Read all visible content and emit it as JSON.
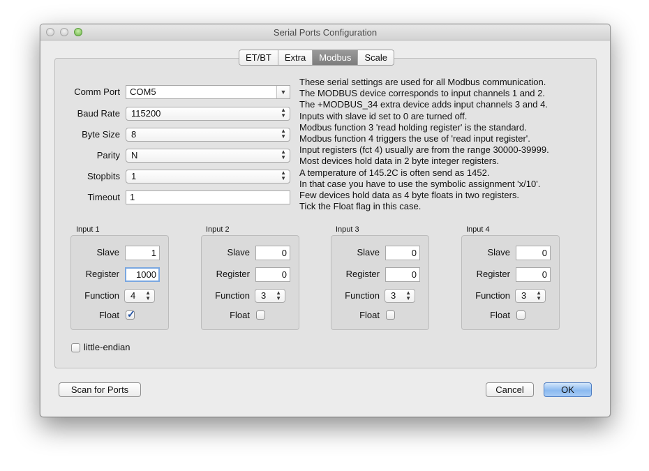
{
  "window": {
    "title": "Serial Ports Configuration"
  },
  "tabs": [
    {
      "label": "ET/BT"
    },
    {
      "label": "Extra"
    },
    {
      "label": "Modbus"
    },
    {
      "label": "Scale"
    }
  ],
  "selected_tab": "Modbus",
  "serial": {
    "comm_port_label": "Comm Port",
    "comm_port": "COM5",
    "baud_rate_label": "Baud Rate",
    "baud_rate": "115200",
    "byte_size_label": "Byte Size",
    "byte_size": "8",
    "parity_label": "Parity",
    "parity": "N",
    "stopbits_label": "Stopbits",
    "stopbits": "1",
    "timeout_label": "Timeout",
    "timeout": "1"
  },
  "info_lines": [
    "These serial settings are used for all Modbus communication.",
    "The MODBUS device corresponds to input channels 1 and 2.",
    "The +MODBUS_34 extra device adds input channels 3 and 4.",
    "Inputs with slave id set to 0 are turned off.",
    "Modbus function 3 'read holding register' is the standard.",
    "Modbus function 4 triggers the use of 'read input register'.",
    "Input registers (fct 4) usually are from the range 30000-39999.",
    "Most devices hold data in 2 byte integer registers.",
    "A temperature of 145.2C is often send as 1452.",
    "In that case you have to use the symbolic assignment 'x/10'.",
    "Few devices hold data as 4 byte floats in two registers.",
    "Tick the Float flag in this case."
  ],
  "field_labels": {
    "slave": "Slave",
    "register": "Register",
    "function": "Function",
    "float": "Float"
  },
  "inputs": [
    {
      "title": "Input 1",
      "slave": "1",
      "register": "1000",
      "function": "4",
      "float": true
    },
    {
      "title": "Input 2",
      "slave": "0",
      "register": "0",
      "function": "3",
      "float": false
    },
    {
      "title": "Input 3",
      "slave": "0",
      "register": "0",
      "function": "3",
      "float": false
    },
    {
      "title": "Input 4",
      "slave": "0",
      "register": "0",
      "function": "3",
      "float": false
    }
  ],
  "little_endian": {
    "label": "little-endian",
    "checked": false
  },
  "buttons": {
    "scan": "Scan for Ports",
    "cancel": "Cancel",
    "ok": "OK"
  },
  "colors": {
    "default_button": "#8bbaf0",
    "selected_tab": "#8a8a8a",
    "checkmark": "#1f4fa0"
  }
}
